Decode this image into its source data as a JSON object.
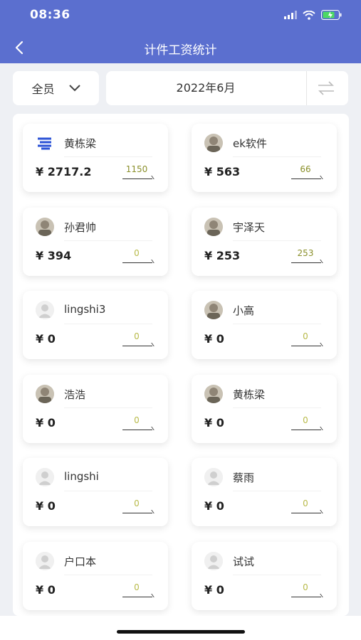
{
  "status": {
    "time": "08:36"
  },
  "header": {
    "title": "计件工资统计"
  },
  "filter": {
    "member_label": "全员"
  },
  "date": {
    "value": "2022年6月"
  },
  "cards": [
    {
      "name": "黄栋梁",
      "amount": "¥ 2717.2",
      "count": "1150",
      "avatar": "logo-avatar"
    },
    {
      "name": "ek软件",
      "amount": "¥ 563",
      "count": "66",
      "avatar": "photo-avatar"
    },
    {
      "name": "孙君帅",
      "amount": "¥ 394",
      "count": "0",
      "avatar": "photo-avatar"
    },
    {
      "name": "宇泽天",
      "amount": "¥ 253",
      "count": "253",
      "avatar": "photo-avatar"
    },
    {
      "name": "lingshi3",
      "amount": "¥ 0",
      "count": "0",
      "avatar": "default-avatar"
    },
    {
      "name": "小高",
      "amount": "¥ 0",
      "count": "0",
      "avatar": "photo-avatar"
    },
    {
      "name": "浩浩",
      "amount": "¥ 0",
      "count": "0",
      "avatar": "photo-avatar"
    },
    {
      "name": "黄栋梁",
      "amount": "¥ 0",
      "count": "0",
      "avatar": "photo-avatar"
    },
    {
      "name": "lingshi",
      "amount": "¥ 0",
      "count": "0",
      "avatar": "default-avatar"
    },
    {
      "name": "蔡雨",
      "amount": "¥ 0",
      "count": "0",
      "avatar": "default-avatar"
    },
    {
      "name": "户口本",
      "amount": "¥ 0",
      "count": "0",
      "avatar": "default-avatar"
    },
    {
      "name": "试试",
      "amount": "¥ 0",
      "count": "0",
      "avatar": "default-avatar"
    }
  ],
  "colors": {
    "header": "#5b6fcf",
    "count": "#8a8f2a"
  }
}
